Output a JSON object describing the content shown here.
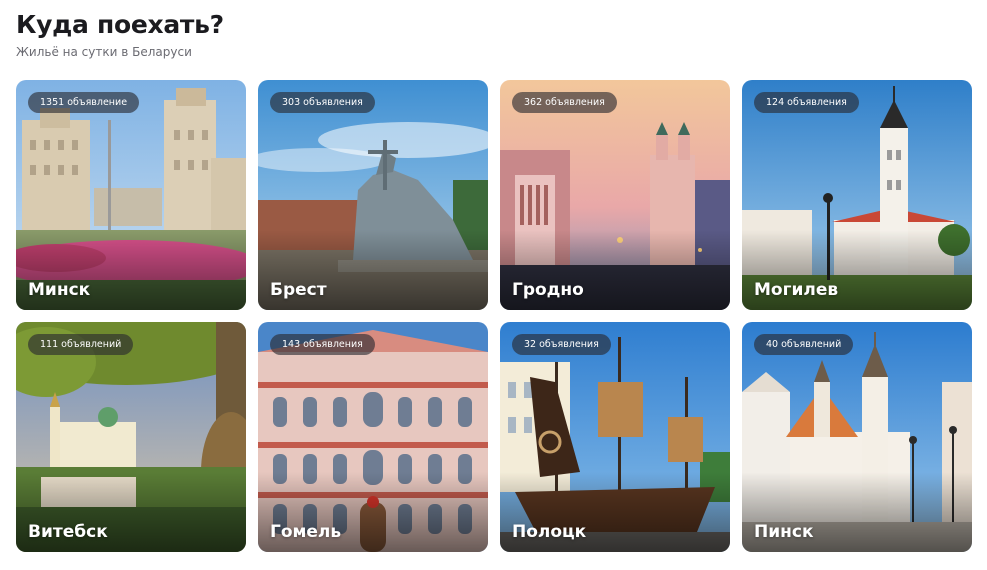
{
  "header": {
    "title": "Куда поехать?",
    "subtitle": "Жильё на сутки в Беларуси"
  },
  "cities": [
    {
      "name": "Минск",
      "listings": "1351 объявление"
    },
    {
      "name": "Брест",
      "listings": "303 объявления"
    },
    {
      "name": "Гродно",
      "listings": "362 объявления"
    },
    {
      "name": "Могилев",
      "listings": "124 объявления"
    },
    {
      "name": "Витебск",
      "listings": "111 объявлений"
    },
    {
      "name": "Гомель",
      "listings": "143 объявления"
    },
    {
      "name": "Полоцк",
      "listings": "32 объявления"
    },
    {
      "name": "Пинск",
      "listings": "40 объявлений"
    }
  ]
}
